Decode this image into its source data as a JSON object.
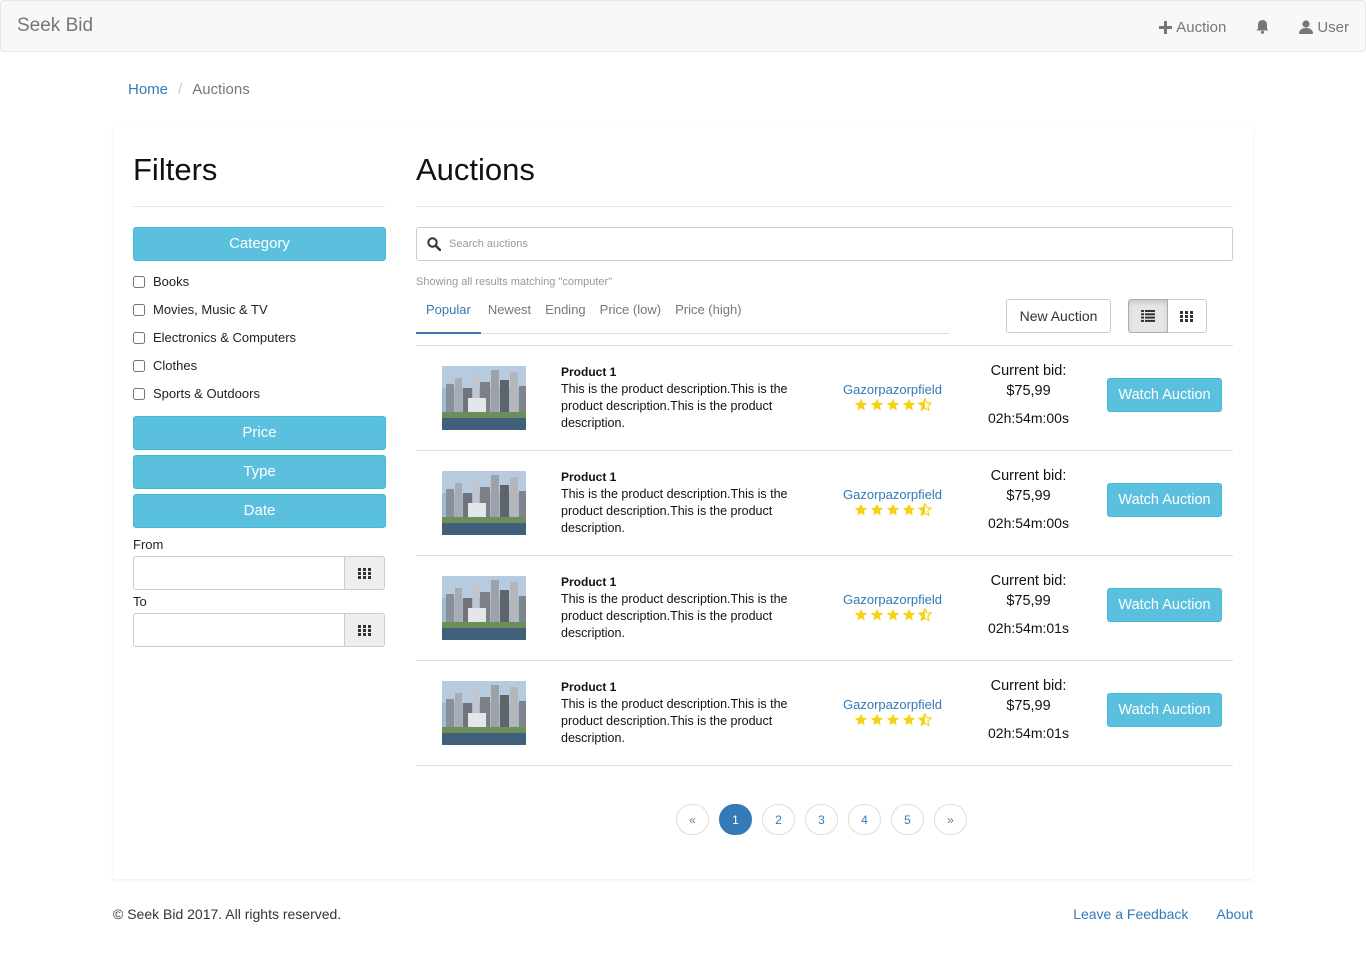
{
  "navbar": {
    "brand": "Seek Bid",
    "auction_link": "Auction",
    "user_link": "User"
  },
  "breadcrumb": {
    "home": "Home",
    "separator": "/",
    "current": "Auctions"
  },
  "filters": {
    "title": "Filters",
    "category_label": "Category",
    "categories": [
      "Books",
      "Movies, Music & TV",
      "Electronics & Computers",
      "Clothes",
      "Sports & Outdoors"
    ],
    "price_label": "Price",
    "type_label": "Type",
    "date_label": "Date",
    "from_label": "From",
    "to_label": "To",
    "from_value": "",
    "to_value": ""
  },
  "auctions": {
    "title": "Auctions",
    "search_placeholder": "Search auctions",
    "search_value": "",
    "results_note": "Showing all results matching \"computer\"",
    "tabs": [
      "Popular",
      "Newest",
      "Ending",
      "Price (low)",
      "Price (high)"
    ],
    "active_tab": "Popular",
    "new_auction_label": "New Auction",
    "view_mode": "list",
    "items": [
      {
        "name": "Product 1",
        "description": "This is the product description.This is the product description.This is the product description.",
        "seller": "Gazorpazorpfield",
        "rating": 4.5,
        "bid_label": "Current bid:",
        "bid": "$75,99",
        "timer": "02h:54m:00s",
        "watch_label": "Watch Auction"
      },
      {
        "name": "Product 1",
        "description": "This is the product description.This is the product description.This is the product description.",
        "seller": "Gazorpazorpfield",
        "rating": 4.5,
        "bid_label": "Current bid:",
        "bid": "$75,99",
        "timer": "02h:54m:00s",
        "watch_label": "Watch Auction"
      },
      {
        "name": "Product 1",
        "description": "This is the product description.This is the product description.This is the product description.",
        "seller": "Gazorpazorpfield",
        "rating": 4.5,
        "bid_label": "Current bid:",
        "bid": "$75,99",
        "timer": "02h:54m:01s",
        "watch_label": "Watch Auction"
      },
      {
        "name": "Product 1",
        "description": "This is the product description.This is the product description.This is the product description.",
        "seller": "Gazorpazorpfield",
        "rating": 4.5,
        "bid_label": "Current bid:",
        "bid": "$75,99",
        "timer": "02h:54m:01s",
        "watch_label": "Watch Auction"
      }
    ]
  },
  "pagination": {
    "prev": "«",
    "pages": [
      "1",
      "2",
      "3",
      "4",
      "5"
    ],
    "active_page": "1",
    "next": "»"
  },
  "footer": {
    "copyright": "© Seek Bid 2017. All rights reserved.",
    "feedback": "Leave a Feedback",
    "about": "About"
  },
  "colors": {
    "info": "#5bc0de",
    "link": "#337ab7",
    "star": "#f5d314"
  },
  "icons": [
    "plus-icon",
    "bell-icon",
    "user-icon",
    "search-icon",
    "calendar-icon",
    "list-view-icon",
    "grid-view-icon",
    "star-icon",
    "half-star-icon"
  ]
}
